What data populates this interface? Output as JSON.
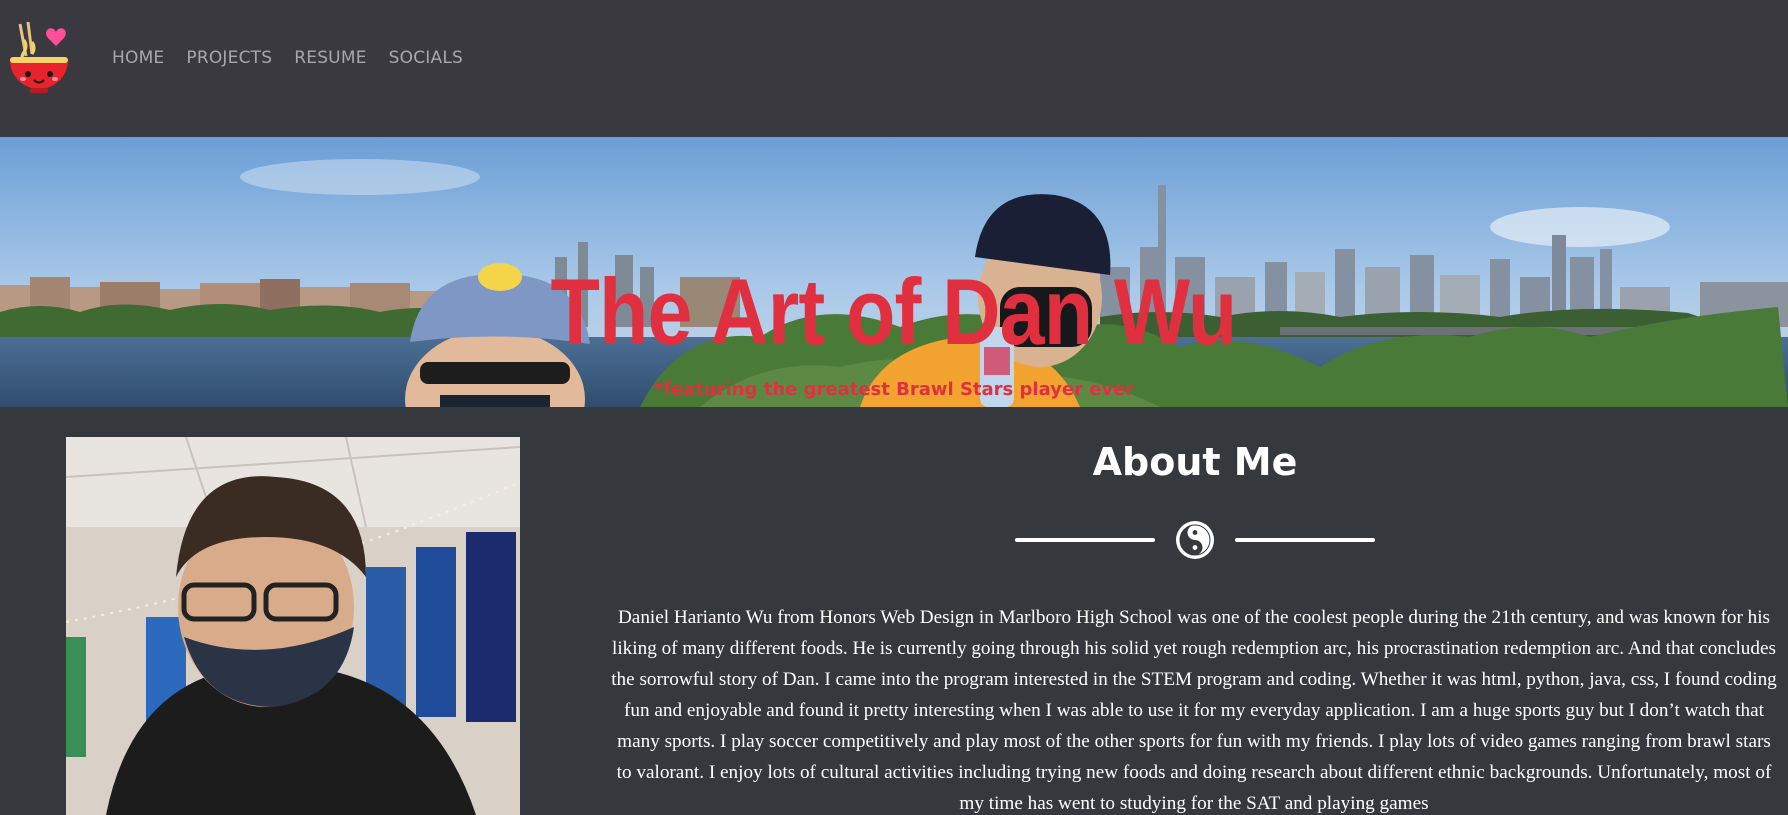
{
  "nav": {
    "items": [
      "HOME",
      "PROJECTS",
      "RESUME",
      "SOCIALS"
    ]
  },
  "logo": {
    "icon": "ramen-bowl-logo-icon"
  },
  "hero": {
    "title": "The Art of Dan Wu",
    "subtitle": "*featuring the greatest Brawl Stars player ever"
  },
  "about": {
    "title": "About Me",
    "divider_icon": "yin-yang-icon",
    "paragraph": "Daniel Harianto Wu from Honors Web Design in Marlboro High School was one of the coolest people during the 21th century, and was known for his liking of many different foods. He is currently going through his solid yet rough redemption arc, his procrastination redemption arc. And that concludes the sorrowful story of Dan. I came into the program interested in the STEM program and coding. Whether it was html, python, java, css, I found coding fun and enjoyable and found it pretty interesting when I was able to use it for my everyday application. I am a huge sports guy but I don’t watch that many sports. I play soccer competitively and play most of the other sports for fun with my friends. I play lots of video games ranging from brawl stars to valorant. I enjoy lots of cultural activities including trying new foods and doing research about different ethnic backgrounds. Unfortunately, most of my time has went to studying for the SAT and playing games"
  },
  "colors": {
    "accent_red": "#e0303f",
    "header_bg": "#39393f",
    "page_bg": "#35383d"
  }
}
